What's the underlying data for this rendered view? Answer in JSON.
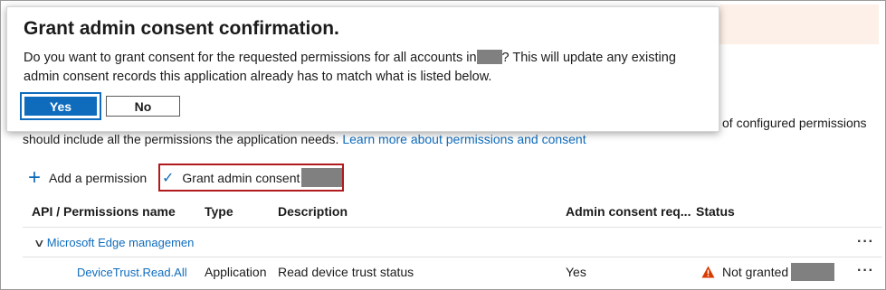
{
  "dialog": {
    "title": "Grant admin consent confirmation.",
    "message_before": "Do you want to grant consent for the requested permissions for all accounts in",
    "message_after": "? This will update any existing admin consent records this application already has to match what is listed below.",
    "yes_label": "Yes",
    "no_label": "No"
  },
  "background": {
    "trailing_text": "of configured permissions",
    "description": "should include all the permissions the application needs.",
    "learn_more": "Learn more about permissions and consent"
  },
  "toolbar": {
    "add_permission": "Add a permission",
    "grant_admin_consent": "Grant admin consent"
  },
  "table": {
    "headers": [
      "API / Permissions name",
      "Type",
      "Description",
      "Admin consent req...",
      "Status"
    ],
    "group_name": "Microsoft Edge managemen",
    "rows": [
      {
        "name": "DeviceTrust.Read.All",
        "type": "Application",
        "description": "Read device trust status",
        "admin_consent": "Yes",
        "status": "Not granted"
      }
    ]
  },
  "icons": {
    "add": "plus-icon",
    "grant": "checkmark-icon",
    "expand": "chevron-down-icon",
    "warning": "warning-icon",
    "more": "more-icon"
  },
  "colors": {
    "accent": "#0f6cbd",
    "highlight_border": "#b2181c",
    "warning": "#d83b01",
    "redaction": "#808080"
  }
}
